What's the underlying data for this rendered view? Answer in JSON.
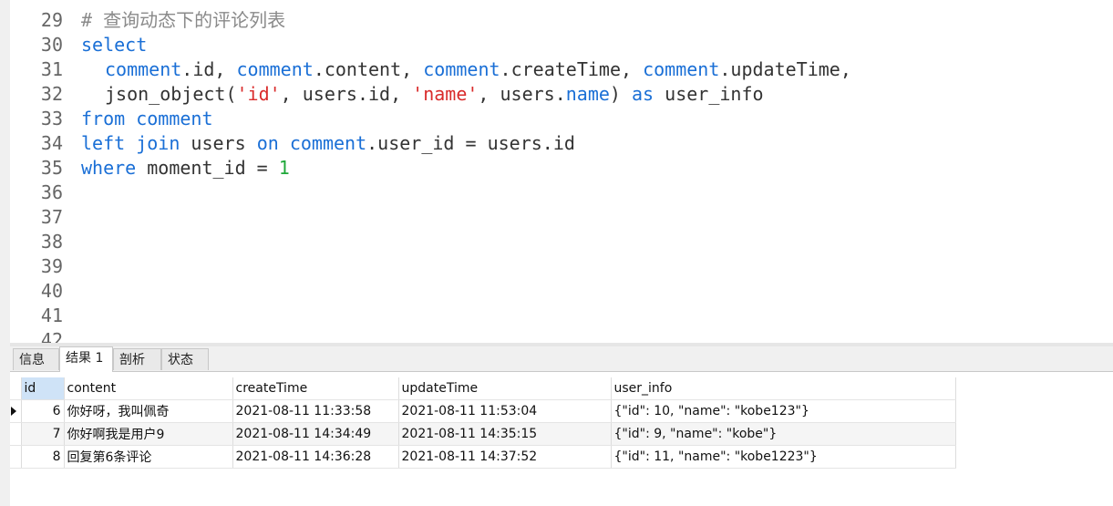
{
  "editor": {
    "lines": [
      {
        "no": "29",
        "segments": [
          {
            "t": "# 查询动态下的评论列表",
            "c": "cmt"
          }
        ]
      },
      {
        "no": "30",
        "segments": [
          {
            "t": "select",
            "c": "kw"
          }
        ]
      },
      {
        "no": "31",
        "indent": true,
        "segments": [
          {
            "t": "comment",
            "c": "kw"
          },
          {
            "t": ".id, ",
            "c": "plain"
          },
          {
            "t": "comment",
            "c": "kw"
          },
          {
            "t": ".content, ",
            "c": "plain"
          },
          {
            "t": "comment",
            "c": "kw"
          },
          {
            "t": ".createTime, ",
            "c": "plain"
          },
          {
            "t": "comment",
            "c": "kw"
          },
          {
            "t": ".updateTime,",
            "c": "plain"
          }
        ]
      },
      {
        "no": "32",
        "indent": true,
        "segments": [
          {
            "t": "json_object(",
            "c": "plain"
          },
          {
            "t": "'id'",
            "c": "str"
          },
          {
            "t": ", users.id, ",
            "c": "plain"
          },
          {
            "t": "'name'",
            "c": "str"
          },
          {
            "t": ", users.",
            "c": "plain"
          },
          {
            "t": "name",
            "c": "kw"
          },
          {
            "t": ") ",
            "c": "plain"
          },
          {
            "t": "as",
            "c": "kw"
          },
          {
            "t": " user_info",
            "c": "plain"
          }
        ]
      },
      {
        "no": "33",
        "segments": [
          {
            "t": "from",
            "c": "kw"
          },
          {
            "t": " ",
            "c": "plain"
          },
          {
            "t": "comment",
            "c": "kw"
          }
        ]
      },
      {
        "no": "34",
        "segments": [
          {
            "t": "left",
            "c": "kw"
          },
          {
            "t": " ",
            "c": "plain"
          },
          {
            "t": "join",
            "c": "kw"
          },
          {
            "t": " users ",
            "c": "plain"
          },
          {
            "t": "on",
            "c": "kw"
          },
          {
            "t": " ",
            "c": "plain"
          },
          {
            "t": "comment",
            "c": "kw"
          },
          {
            "t": ".user_id = users.id",
            "c": "plain"
          }
        ]
      },
      {
        "no": "35",
        "segments": [
          {
            "t": "where",
            "c": "kw"
          },
          {
            "t": " moment_id = ",
            "c": "plain"
          },
          {
            "t": "1",
            "c": "num"
          }
        ]
      },
      {
        "no": "36",
        "segments": []
      },
      {
        "no": "37",
        "segments": []
      },
      {
        "no": "38",
        "segments": []
      },
      {
        "no": "39",
        "segments": []
      },
      {
        "no": "40",
        "segments": []
      },
      {
        "no": "41",
        "segments": []
      },
      {
        "no": "42",
        "segments": []
      }
    ]
  },
  "tabs": [
    {
      "label": "信息",
      "active": false
    },
    {
      "label": "结果 1",
      "active": true
    },
    {
      "label": "剖析",
      "active": false
    },
    {
      "label": "状态",
      "active": false
    }
  ],
  "result": {
    "columns": [
      "id",
      "content",
      "createTime",
      "updateTime",
      "user_info"
    ],
    "rows": [
      [
        "6",
        "你好呀，我叫佩奇",
        "2021-08-11 11:33:58",
        "2021-08-11 11:53:04",
        "{\"id\": 10, \"name\": \"kobe123\"}"
      ],
      [
        "7",
        "你好啊我是用户9",
        "2021-08-11 14:34:49",
        "2021-08-11 14:35:15",
        "{\"id\": 9, \"name\": \"kobe\"}"
      ],
      [
        "8",
        "回复第6条评论",
        "2021-08-11 14:36:28",
        "2021-08-11 14:37:52",
        "{\"id\": 11, \"name\": \"kobe1223\"}"
      ]
    ],
    "current_row": 0
  },
  "colors": {
    "keyword": "#1a6fd6",
    "string": "#d92b2b",
    "number": "#1fa83a",
    "comment": "#8a8a8a",
    "selected_header": "#cfe3f7"
  }
}
